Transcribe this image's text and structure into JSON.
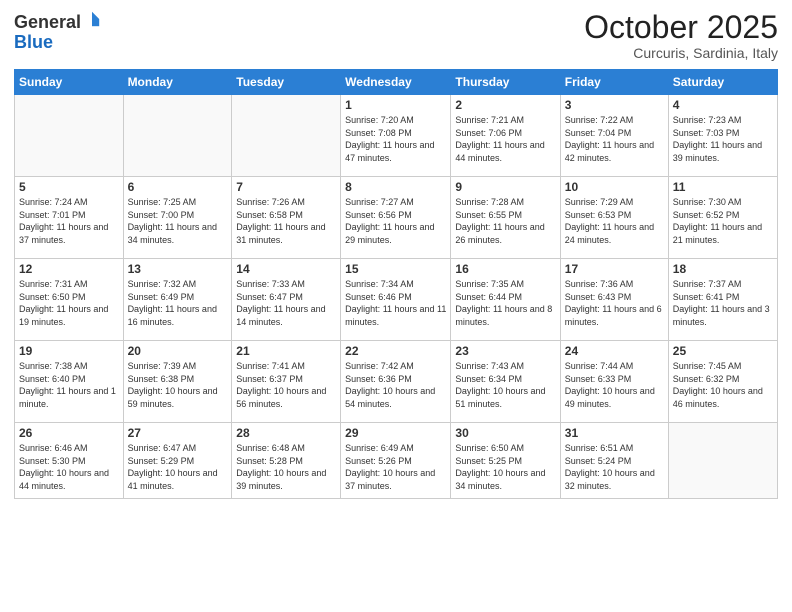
{
  "logo": {
    "general": "General",
    "blue": "Blue"
  },
  "header": {
    "month": "October 2025",
    "location": "Curcuris, Sardinia, Italy"
  },
  "days_of_week": [
    "Sunday",
    "Monday",
    "Tuesday",
    "Wednesday",
    "Thursday",
    "Friday",
    "Saturday"
  ],
  "weeks": [
    [
      {
        "day": "",
        "info": ""
      },
      {
        "day": "",
        "info": ""
      },
      {
        "day": "",
        "info": ""
      },
      {
        "day": "1",
        "info": "Sunrise: 7:20 AM\nSunset: 7:08 PM\nDaylight: 11 hours and 47 minutes."
      },
      {
        "day": "2",
        "info": "Sunrise: 7:21 AM\nSunset: 7:06 PM\nDaylight: 11 hours and 44 minutes."
      },
      {
        "day": "3",
        "info": "Sunrise: 7:22 AM\nSunset: 7:04 PM\nDaylight: 11 hours and 42 minutes."
      },
      {
        "day": "4",
        "info": "Sunrise: 7:23 AM\nSunset: 7:03 PM\nDaylight: 11 hours and 39 minutes."
      }
    ],
    [
      {
        "day": "5",
        "info": "Sunrise: 7:24 AM\nSunset: 7:01 PM\nDaylight: 11 hours and 37 minutes."
      },
      {
        "day": "6",
        "info": "Sunrise: 7:25 AM\nSunset: 7:00 PM\nDaylight: 11 hours and 34 minutes."
      },
      {
        "day": "7",
        "info": "Sunrise: 7:26 AM\nSunset: 6:58 PM\nDaylight: 11 hours and 31 minutes."
      },
      {
        "day": "8",
        "info": "Sunrise: 7:27 AM\nSunset: 6:56 PM\nDaylight: 11 hours and 29 minutes."
      },
      {
        "day": "9",
        "info": "Sunrise: 7:28 AM\nSunset: 6:55 PM\nDaylight: 11 hours and 26 minutes."
      },
      {
        "day": "10",
        "info": "Sunrise: 7:29 AM\nSunset: 6:53 PM\nDaylight: 11 hours and 24 minutes."
      },
      {
        "day": "11",
        "info": "Sunrise: 7:30 AM\nSunset: 6:52 PM\nDaylight: 11 hours and 21 minutes."
      }
    ],
    [
      {
        "day": "12",
        "info": "Sunrise: 7:31 AM\nSunset: 6:50 PM\nDaylight: 11 hours and 19 minutes."
      },
      {
        "day": "13",
        "info": "Sunrise: 7:32 AM\nSunset: 6:49 PM\nDaylight: 11 hours and 16 minutes."
      },
      {
        "day": "14",
        "info": "Sunrise: 7:33 AM\nSunset: 6:47 PM\nDaylight: 11 hours and 14 minutes."
      },
      {
        "day": "15",
        "info": "Sunrise: 7:34 AM\nSunset: 6:46 PM\nDaylight: 11 hours and 11 minutes."
      },
      {
        "day": "16",
        "info": "Sunrise: 7:35 AM\nSunset: 6:44 PM\nDaylight: 11 hours and 8 minutes."
      },
      {
        "day": "17",
        "info": "Sunrise: 7:36 AM\nSunset: 6:43 PM\nDaylight: 11 hours and 6 minutes."
      },
      {
        "day": "18",
        "info": "Sunrise: 7:37 AM\nSunset: 6:41 PM\nDaylight: 11 hours and 3 minutes."
      }
    ],
    [
      {
        "day": "19",
        "info": "Sunrise: 7:38 AM\nSunset: 6:40 PM\nDaylight: 11 hours and 1 minute."
      },
      {
        "day": "20",
        "info": "Sunrise: 7:39 AM\nSunset: 6:38 PM\nDaylight: 10 hours and 59 minutes."
      },
      {
        "day": "21",
        "info": "Sunrise: 7:41 AM\nSunset: 6:37 PM\nDaylight: 10 hours and 56 minutes."
      },
      {
        "day": "22",
        "info": "Sunrise: 7:42 AM\nSunset: 6:36 PM\nDaylight: 10 hours and 54 minutes."
      },
      {
        "day": "23",
        "info": "Sunrise: 7:43 AM\nSunset: 6:34 PM\nDaylight: 10 hours and 51 minutes."
      },
      {
        "day": "24",
        "info": "Sunrise: 7:44 AM\nSunset: 6:33 PM\nDaylight: 10 hours and 49 minutes."
      },
      {
        "day": "25",
        "info": "Sunrise: 7:45 AM\nSunset: 6:32 PM\nDaylight: 10 hours and 46 minutes."
      }
    ],
    [
      {
        "day": "26",
        "info": "Sunrise: 6:46 AM\nSunset: 5:30 PM\nDaylight: 10 hours and 44 minutes."
      },
      {
        "day": "27",
        "info": "Sunrise: 6:47 AM\nSunset: 5:29 PM\nDaylight: 10 hours and 41 minutes."
      },
      {
        "day": "28",
        "info": "Sunrise: 6:48 AM\nSunset: 5:28 PM\nDaylight: 10 hours and 39 minutes."
      },
      {
        "day": "29",
        "info": "Sunrise: 6:49 AM\nSunset: 5:26 PM\nDaylight: 10 hours and 37 minutes."
      },
      {
        "day": "30",
        "info": "Sunrise: 6:50 AM\nSunset: 5:25 PM\nDaylight: 10 hours and 34 minutes."
      },
      {
        "day": "31",
        "info": "Sunrise: 6:51 AM\nSunset: 5:24 PM\nDaylight: 10 hours and 32 minutes."
      },
      {
        "day": "",
        "info": ""
      }
    ]
  ]
}
